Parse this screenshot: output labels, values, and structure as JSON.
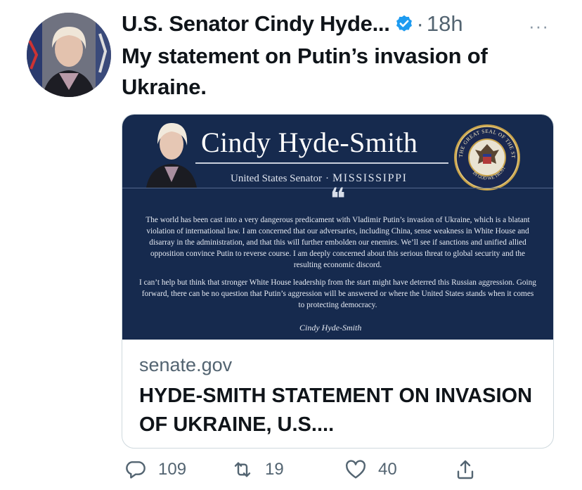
{
  "tweet": {
    "author_name": "U.S. Senator Cindy Hyde...",
    "separator": "·",
    "time": "18h",
    "more": "···",
    "text": "My statement on Putin’s invasion of Ukraine."
  },
  "card": {
    "image": {
      "name": "Cindy Hyde-Smith",
      "subtitle_left": "United States Senator",
      "subtitle_sep": "·",
      "subtitle_state": "MISSISSIPPI",
      "seal_text": "THE GREAT SEAL OF THE STATE OF MISSISSIPPI",
      "seal_motto": "IN GOD WE TRUST",
      "quote_mark": "❝",
      "paragraph_1": "The world has been cast into a very dangerous predicament with Vladimir Putin’s invasion of Ukraine, which is a blatant violation of international law. I am concerned that our adversaries, including China, sense weakness in White House and disarray in the administration, and that this will further embolden our enemies. We’ll see if sanctions and unified allied opposition convince Putin to reverse course. I am deeply concerned about this serious threat to global security and the resulting economic discord.",
      "paragraph_2": "I can’t help but think that stronger White House leadership from the start might have deterred this Russian aggression. Going forward, there can be no question that Putin’s aggression will be answered or where the United States stands when it comes to protecting democracy.",
      "signature": "Cindy Hyde-Smith"
    },
    "domain": "senate.gov",
    "title": "HYDE-SMITH STATEMENT ON INVASION OF UKRAINE, U.S...."
  },
  "actions": {
    "replies": "109",
    "retweets": "19",
    "likes": "40"
  },
  "colors": {
    "verified_blue": "#1d9bf0",
    "card_navy": "#162a4e",
    "muted_text": "#536471"
  }
}
